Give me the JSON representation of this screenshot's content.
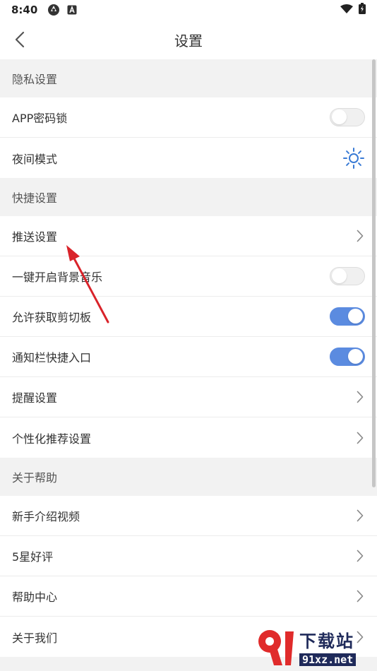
{
  "status": {
    "time": "8:40"
  },
  "header": {
    "title": "设置"
  },
  "sections": [
    {
      "title": "隐私设置",
      "items": [
        {
          "label": "APP密码锁",
          "control": "toggle",
          "on": false
        },
        {
          "label": "夜间模式",
          "control": "sun"
        }
      ]
    },
    {
      "title": "快捷设置",
      "items": [
        {
          "label": "推送设置",
          "control": "chevron"
        },
        {
          "label": "一键开启背景音乐",
          "control": "toggle",
          "on": false
        },
        {
          "label": "允许获取剪切板",
          "control": "toggle",
          "on": true
        },
        {
          "label": "通知栏快捷入口",
          "control": "toggle",
          "on": true
        },
        {
          "label": "提醒设置",
          "control": "chevron"
        },
        {
          "label": "个性化推荐设置",
          "control": "chevron"
        }
      ]
    },
    {
      "title": "关于帮助",
      "items": [
        {
          "label": "新手介绍视频",
          "control": "chevron"
        },
        {
          "label": "5星好评",
          "control": "chevron"
        },
        {
          "label": "帮助中心",
          "control": "chevron"
        },
        {
          "label": "关于我们",
          "control": "chevron"
        }
      ]
    }
  ],
  "watermark": {
    "big": "下载站",
    "url": "91xz.net"
  },
  "colors": {
    "accent": "#5b8be0",
    "sun": "#3a7bd5",
    "arrow": "#d9232a"
  }
}
